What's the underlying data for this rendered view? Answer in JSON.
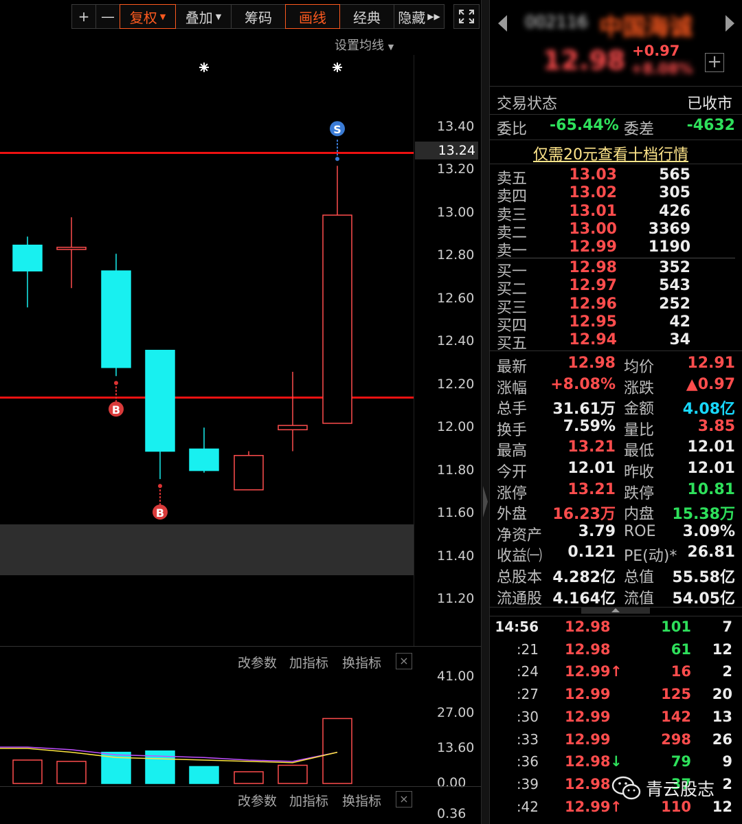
{
  "toolbar": {
    "buttons": [
      {
        "label": "+",
        "active": false,
        "dropdown": false
      },
      {
        "label": "—",
        "active": false,
        "dropdown": false
      },
      {
        "label": "复权",
        "active": true,
        "dropdown": true
      },
      {
        "label": "叠加",
        "active": false,
        "dropdown": true
      },
      {
        "label": "筹码",
        "active": false,
        "dropdown": false
      },
      {
        "label": "画线",
        "active": true,
        "dropdown": false
      },
      {
        "label": "经典",
        "active": false,
        "dropdown": false
      },
      {
        "label": "隐藏",
        "active": false,
        "dropdown": false
      }
    ],
    "setma_label": "设置均线"
  },
  "chart_data": [
    {
      "type": "candlestick",
      "title": "",
      "y_ticks": [
        "13.40",
        "13.20",
        "13.00",
        "12.80",
        "12.60",
        "12.40",
        "12.20",
        "12.00",
        "11.80",
        "11.60",
        "11.40",
        "11.20"
      ],
      "ylim": [
        11.2,
        13.4
      ],
      "current_price": "13.24",
      "candles": [
        {
          "open": 12.85,
          "close": 12.73,
          "high": 12.89,
          "low": 12.56
        },
        {
          "open": 12.83,
          "close": 12.84,
          "high": 12.98,
          "low": 12.65
        },
        {
          "open": 12.73,
          "close": 12.28,
          "high": 12.81,
          "low": 12.24
        },
        {
          "open": 12.36,
          "close": 11.89,
          "high": 12.36,
          "low": 11.76
        },
        {
          "open": 11.9,
          "close": 11.8,
          "high": 12.0,
          "low": 11.79
        },
        {
          "open": 11.71,
          "close": 11.87,
          "high": 11.89,
          "low": 11.71
        },
        {
          "open": 11.99,
          "close": 12.01,
          "high": 12.26,
          "low": 11.89
        },
        {
          "open": 12.02,
          "close": 12.99,
          "high": 13.22,
          "low": 12.02
        }
      ],
      "horizontal_lines": [
        13.28,
        12.14
      ],
      "markers": [
        {
          "candle": 2,
          "label": "B",
          "kind": "buy"
        },
        {
          "candle": 3,
          "label": "B",
          "kind": "buy"
        },
        {
          "candle": 7,
          "label": "S",
          "kind": "sell"
        }
      ],
      "star_markers": [
        4,
        7
      ]
    },
    {
      "type": "bar",
      "title": "",
      "y_ticks": [
        "41.00",
        "27.00",
        "13.60",
        "0.00"
      ],
      "ylim": [
        0,
        41
      ],
      "values": [
        9,
        8.5,
        12,
        12.5,
        6.5,
        4.5,
        7,
        25
      ],
      "bar_colors": [
        "red",
        "red",
        "cyan",
        "cyan",
        "cyan",
        "red",
        "red",
        "red"
      ],
      "ma_lines": [
        {
          "color": "#c050ff",
          "values": [
            14,
            13,
            11,
            10.5,
            10,
            9,
            8.5,
            12
          ]
        },
        {
          "color": "#ffe640",
          "values": [
            13.5,
            12,
            10,
            9.5,
            9,
            8.5,
            8,
            12
          ]
        }
      ]
    }
  ],
  "sub_panel": {
    "controls": [
      "改参数",
      "加指标",
      "换指标"
    ],
    "close": "×",
    "lower_tick": "0.36"
  },
  "quote": {
    "code": "002116",
    "name": "中国海诚",
    "price": "12.98",
    "change": "+0.97",
    "change_pct": "+8.08%",
    "add_label": "+",
    "status_label": "交易状态",
    "status_value": "已收市",
    "wb_label": "委比",
    "wb_value": "-65.44%",
    "wc_label": "委差",
    "wc_value": "-4632",
    "promo": "仅需20元查看十档行情"
  },
  "orderbook": {
    "asks": [
      {
        "label": "卖五",
        "price": "13.03",
        "vol": "565"
      },
      {
        "label": "卖四",
        "price": "13.02",
        "vol": "305"
      },
      {
        "label": "卖三",
        "price": "13.01",
        "vol": "426"
      },
      {
        "label": "卖二",
        "price": "13.00",
        "vol": "3369"
      },
      {
        "label": "卖一",
        "price": "12.99",
        "vol": "1190"
      }
    ],
    "bids": [
      {
        "label": "买一",
        "price": "12.98",
        "vol": "352"
      },
      {
        "label": "买二",
        "price": "12.97",
        "vol": "543"
      },
      {
        "label": "买三",
        "price": "12.96",
        "vol": "252"
      },
      {
        "label": "买四",
        "price": "12.95",
        "vol": "42"
      },
      {
        "label": "买五",
        "price": "12.94",
        "vol": "34"
      }
    ]
  },
  "stats": [
    {
      "l1": "最新",
      "v1": "12.98",
      "c1": "red",
      "l2": "均价",
      "v2": "12.91",
      "c2": "red"
    },
    {
      "l1": "涨幅",
      "v1": "+8.08%",
      "c1": "red",
      "l2": "涨跌",
      "v2": "▲0.97",
      "c2": "red"
    },
    {
      "l1": "总手",
      "v1": "31.61万",
      "c1": "wht",
      "l2": "金额",
      "v2": "4.08亿",
      "c2": "cyn"
    },
    {
      "l1": "换手",
      "v1": "7.59%",
      "c1": "wht",
      "l2": "量比",
      "v2": "3.85",
      "c2": "red"
    },
    {
      "l1": "最高",
      "v1": "13.21",
      "c1": "red",
      "l2": "最低",
      "v2": "12.01",
      "c2": "wht"
    },
    {
      "l1": "今开",
      "v1": "12.01",
      "c1": "wht",
      "l2": "昨收",
      "v2": "12.01",
      "c2": "wht"
    },
    {
      "l1": "涨停",
      "v1": "13.21",
      "c1": "red",
      "l2": "跌停",
      "v2": "10.81",
      "c2": "grn"
    },
    {
      "l1": "外盘",
      "v1": "16.23万",
      "c1": "red",
      "l2": "内盘",
      "v2": "15.38万",
      "c2": "grn"
    },
    {
      "l1": "净资产",
      "v1": "3.79",
      "c1": "wht",
      "l2": "ROE",
      "v2": "3.09%",
      "c2": "wht"
    },
    {
      "l1": "收益㈠",
      "v1": "0.121",
      "c1": "wht",
      "l2": "PE(动)*",
      "v2": "26.81",
      "c2": "wht"
    },
    {
      "l1": "总股本",
      "v1": "4.282亿",
      "c1": "wht",
      "l2": "总值",
      "v2": "55.58亿",
      "c2": "wht"
    },
    {
      "l1": "流通股",
      "v1": "4.164亿",
      "c1": "wht",
      "l2": "流值",
      "v2": "54.05亿",
      "c2": "wht"
    }
  ],
  "ticks": [
    {
      "time": "14:56",
      "price": "12.98",
      "arrow": "",
      "vol": "101",
      "vcolor": "grn",
      "num": "7"
    },
    {
      "time": ":21",
      "price": "12.98",
      "arrow": "",
      "vol": "61",
      "vcolor": "grn",
      "num": "12"
    },
    {
      "time": ":24",
      "price": "12.99",
      "arrow": "↑",
      "vol": "16",
      "vcolor": "red",
      "num": "2"
    },
    {
      "time": ":27",
      "price": "12.99",
      "arrow": "",
      "vol": "125",
      "vcolor": "red",
      "num": "20"
    },
    {
      "time": ":30",
      "price": "12.99",
      "arrow": "",
      "vol": "142",
      "vcolor": "red",
      "num": "13"
    },
    {
      "time": ":33",
      "price": "12.99",
      "arrow": "",
      "vol": "298",
      "vcolor": "red",
      "num": "26"
    },
    {
      "time": ":36",
      "price": "12.98",
      "arrow": "↓",
      "vol": "79",
      "vcolor": "grn",
      "num": "9"
    },
    {
      "time": ":39",
      "price": "12.98",
      "arrow": "",
      "vol": "37",
      "vcolor": "grn",
      "num": "2"
    },
    {
      "time": ":42",
      "price": "12.99",
      "arrow": "↑",
      "vol": "110",
      "vcolor": "red",
      "num": "12"
    }
  ],
  "watermark": "青云股志",
  "colors": {
    "up": "#ff4d4d",
    "down": "#18f0f0",
    "line": "#ee1111",
    "accent": "#ff5a1f"
  }
}
